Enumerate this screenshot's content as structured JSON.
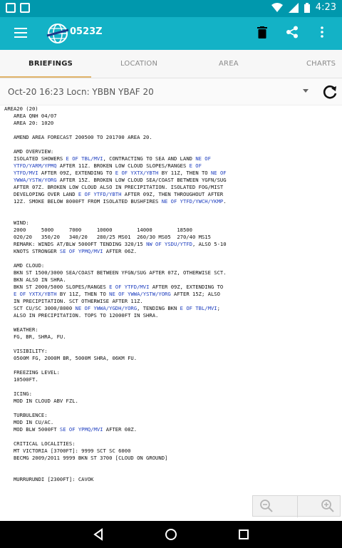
{
  "status_bar": {
    "time": "4:23"
  },
  "app_bar": {
    "title": "0523Z"
  },
  "tabs": [
    {
      "label": "BRIEFINGS",
      "active": true
    },
    {
      "label": "LOCATION",
      "active": false
    },
    {
      "label": "AREA",
      "active": false
    },
    {
      "label": "CHARTS",
      "active": false
    }
  ],
  "header": {
    "label": "Oct-20 16:23 Locn: YBBN YBAF 20"
  },
  "forecast_lines": [
    [
      {
        "t": "AREA20 (20)"
      }
    ],
    [
      {
        "t": "   AREA QNH 04/07"
      }
    ],
    [
      {
        "t": "   AREA 20: 1020"
      }
    ],
    [
      {
        "t": ""
      }
    ],
    [
      {
        "t": "   AMEND AREA FORECAST 200500 TO 201700 AREA 20."
      }
    ],
    [
      {
        "t": ""
      }
    ],
    [
      {
        "t": "   AMD OVERVIEW:"
      }
    ],
    [
      {
        "t": "   ISOLATED SHOWERS "
      },
      {
        "t": "E OF TBL/MVI",
        "loc": true
      },
      {
        "t": ", CONTRACTING TO SEA AND LAND "
      },
      {
        "t": "NE OF",
        "loc": true
      }
    ],
    [
      {
        "t": "   "
      },
      {
        "t": "YTFD/YARM/YPMQ",
        "loc": true
      },
      {
        "t": " AFTER 11Z. BROKEN LOW CLOUD SLOPES/RANGES "
      },
      {
        "t": "E OF",
        "loc": true
      }
    ],
    [
      {
        "t": "   "
      },
      {
        "t": "YTFD/MVI",
        "loc": true
      },
      {
        "t": " AFTER 09Z, EXTENDING TO "
      },
      {
        "t": "E OF YXTX/YBTH",
        "loc": true
      },
      {
        "t": " BY 11Z, THEN TO "
      },
      {
        "t": "NE OF",
        "loc": true
      }
    ],
    [
      {
        "t": "   "
      },
      {
        "t": "YWWA/YSTW/YORG",
        "loc": true
      },
      {
        "t": " AFTER 15Z. BROKEN LOW CLOUD SEA/COAST BETWEEN YGFN/SUG"
      }
    ],
    [
      {
        "t": "   AFTER 07Z. BROKEN LOW CLOUD ALSO IN PRECIPITATION. ISOLATED FOG/MIST"
      }
    ],
    [
      {
        "t": "   DEVELOPING OVER LAND "
      },
      {
        "t": "E OF YTFD/YBTH",
        "loc": true
      },
      {
        "t": " AFTER 09Z, THEN THROUGHOUT AFTER"
      }
    ],
    [
      {
        "t": "   12Z. SMOKE BELOW 8000FT FROM ISOLATED BUSHFIRES "
      },
      {
        "t": "NE OF YTFD/YWCH/YKMP",
        "loc": true
      },
      {
        "t": "."
      }
    ],
    [
      {
        "t": ""
      }
    ],
    [
      {
        "t": ""
      }
    ],
    [
      {
        "t": "   WIND:"
      }
    ],
    [
      {
        "t": "   2000     5000     7000     10000        14000        18500"
      }
    ],
    [
      {
        "t": "   020/20   350/20   340/20   280/25 MS01  260/30 MS05  270/40 MS15"
      }
    ],
    [
      {
        "t": "   REMARK: WINDS AT/BLW 5000FT TENDING 320/15 "
      },
      {
        "t": "NW OF YSDU/YTFD",
        "loc": true
      },
      {
        "t": ", ALSO 5-10"
      }
    ],
    [
      {
        "t": "   KNOTS STRONGER "
      },
      {
        "t": "SE OF YPMQ/MVI",
        "loc": true
      },
      {
        "t": " AFTER 06Z."
      }
    ],
    [
      {
        "t": ""
      }
    ],
    [
      {
        "t": "   AMD CLOUD:"
      }
    ],
    [
      {
        "t": "   BKN ST 1500/3000 SEA/COAST BETWEEN YFGN/SUG AFTER 07Z, OTHERWISE SCT."
      }
    ],
    [
      {
        "t": "   BKN ALSO IN SHRA."
      }
    ],
    [
      {
        "t": "   BKN ST 2000/5000 SLOPES/RANGES "
      },
      {
        "t": "E OF YTFD/MVI",
        "loc": true
      },
      {
        "t": " AFTER 09Z, EXTENDING TO"
      }
    ],
    [
      {
        "t": "   "
      },
      {
        "t": "E OF YXTX/YBTH",
        "loc": true
      },
      {
        "t": " BY 11Z, THEN TO "
      },
      {
        "t": "NE OF YWWA/YSTW/YORG",
        "loc": true
      },
      {
        "t": " AFTER 15Z; ALSO"
      }
    ],
    [
      {
        "t": "   IN PRECIPITATION. SCT OTHERWISE AFTER 11Z."
      }
    ],
    [
      {
        "t": "   SCT CU/SC 3000/8000 "
      },
      {
        "t": "NE OF YWWA/YGDH/YORG",
        "loc": true
      },
      {
        "t": ", TENDING BKN "
      },
      {
        "t": "E OF TBL/MVI",
        "loc": true
      },
      {
        "t": ";"
      }
    ],
    [
      {
        "t": "   ALSO IN PRECIPITATION. TOPS TO 12000FT IN SHRA."
      }
    ],
    [
      {
        "t": ""
      }
    ],
    [
      {
        "t": "   WEATHER:"
      }
    ],
    [
      {
        "t": "   FG, BR, SHRA, FU."
      }
    ],
    [
      {
        "t": ""
      }
    ],
    [
      {
        "t": "   VISIBILITY:"
      }
    ],
    [
      {
        "t": "   0500M FG, 2000M BR, 5000M SHRA, 06KM FU."
      }
    ],
    [
      {
        "t": ""
      }
    ],
    [
      {
        "t": "   FREEZING LEVEL:"
      }
    ],
    [
      {
        "t": "   10500FT."
      }
    ],
    [
      {
        "t": ""
      }
    ],
    [
      {
        "t": "   ICING:"
      }
    ],
    [
      {
        "t": "   MOD IN CLOUD ABV FZL."
      }
    ],
    [
      {
        "t": ""
      }
    ],
    [
      {
        "t": "   TURBULENCE:"
      }
    ],
    [
      {
        "t": "   MOD IN CU/AC."
      }
    ],
    [
      {
        "t": "   MOD BLW 5000FT "
      },
      {
        "t": "SE OF YPMQ/MVI",
        "loc": true
      },
      {
        "t": " AFTER 08Z."
      }
    ],
    [
      {
        "t": ""
      }
    ],
    [
      {
        "t": "   CRITICAL LOCALITIES:"
      }
    ],
    [
      {
        "t": "   MT VICTORIA [3700FT]: 9999 SCT SC 6000"
      }
    ],
    [
      {
        "t": "   BECMG 2009/2011 9999 BKN ST 3700 [CLOUD ON GROUND]"
      }
    ],
    [
      {
        "t": ""
      }
    ],
    [
      {
        "t": ""
      }
    ],
    [
      {
        "t": "   MURRURUNDI [2300FT]: CAVOK"
      }
    ]
  ],
  "colors": {
    "status_bar": "#0098ad",
    "app_bar": "#13b2c6",
    "location_link": "#1f3fbf",
    "tab_indicator": "#e0b46a"
  },
  "icons": {
    "menu": "menu-icon",
    "logo": "globe-logo-icon",
    "delete": "trash-icon",
    "share": "share-icon",
    "overflow": "more-vert-icon",
    "refresh": "refresh-icon",
    "zoom_out": "zoom-out-icon",
    "zoom_in": "zoom-in-icon"
  }
}
